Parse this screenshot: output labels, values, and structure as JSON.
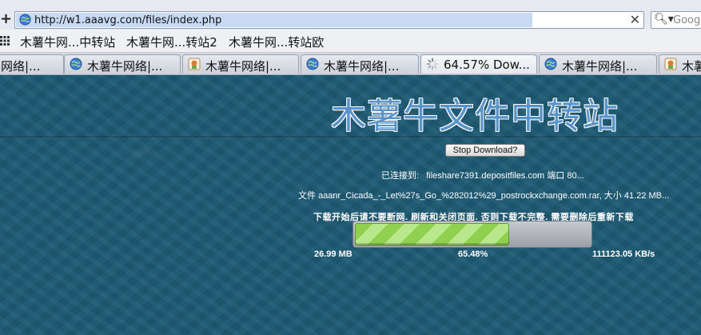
{
  "browser": {
    "url": "http://w1.aaavg.com/files/index.php",
    "search_placeholder": "Googl",
    "bookmarks": [
      "木薯牛网...中转站",
      "木薯牛网...转站2",
      "木薯牛网...转站欧"
    ],
    "tabs": [
      {
        "label": "网络|...",
        "icon": "globe-icon",
        "active": false
      },
      {
        "label": "木薯牛网络|...",
        "icon": "globe-icon",
        "active": false
      },
      {
        "label": "木薯牛网络|...",
        "icon": "site-logo-icon",
        "active": false
      },
      {
        "label": "木薯牛网络|...",
        "icon": "globe-icon",
        "active": false
      },
      {
        "label": "64.57% Dow...",
        "icon": "loading-spinner-icon",
        "active": true
      },
      {
        "label": "木薯牛网络|...",
        "icon": "globe-icon",
        "active": false
      },
      {
        "label": "木薯",
        "icon": "site-logo-icon",
        "active": false
      }
    ]
  },
  "page": {
    "site_title": "木薯牛文件中转站",
    "stop_button_label": "Stop Download?",
    "connected_prefix": "已连接到:",
    "connected_host": "fileshare7391.depositfiles.com",
    "connected_port_label": "端口",
    "connected_port": "80...",
    "file_prefix": "文件",
    "file_name": "aaanr_Cicada_-_Let%27s_Go_%282012%29_postrockxchange.com.rar,",
    "size_label": "大小",
    "file_size": "41.22 MB...",
    "warning": "下载开始后请不要断网. 刷新和关闭页面. 否则下载不完整. 需要删除后重新下载",
    "progress": {
      "downloaded": "26.99 MB",
      "percent_text": "65.48%",
      "fraction": 0.6548,
      "speed": "111123.05 KB/s"
    }
  },
  "colors": {
    "page_background": "#1e5a74",
    "progress_green": "#8fd14f",
    "title_blue": "#5a93c8"
  }
}
